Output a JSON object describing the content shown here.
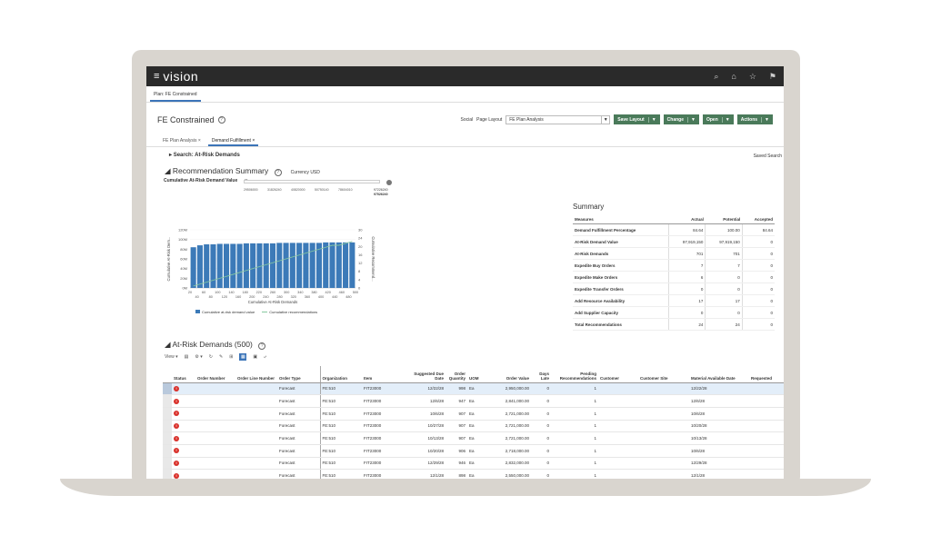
{
  "app": {
    "brand": "vision",
    "tab": "Plan: FE Constrained"
  },
  "header": {
    "title": "FE Constrained",
    "social": "Social",
    "page_layout_label": "Page Layout",
    "page_layout_value": "FE Plan Analysis",
    "buttons": [
      "Save Layout",
      "Change",
      "Open",
      "Actions"
    ]
  },
  "subtabs": [
    "FE Plan Analysis",
    "Demand Fulfillment"
  ],
  "search": {
    "label": "Search: At-Risk Demands",
    "saved": "Saved Search"
  },
  "recommendation": {
    "title": "Recommendation Summary",
    "currency": "Currency  USD",
    "slider_label": "Cumulative At-Risk Demand Value",
    "slider_min": "--",
    "slider_ticks": [
      "29506000",
      "31826240",
      "40820000",
      "50750140",
      "78604010"
    ],
    "slider_max": "97226240",
    "slider_max_bold": "97526240"
  },
  "chart_data": {
    "type": "bar",
    "xlabel": "Cumulative At-Risk Demands",
    "ylabel": "Cumulative At-Risk Dem...",
    "y2label": "Cumulative Recommend...",
    "y_ticks": [
      "120M",
      "100M",
      "80M",
      "60M",
      "40M",
      "20M",
      "0M"
    ],
    "y2_ticks": [
      "30",
      "24",
      "20",
      "16",
      "12",
      "8",
      "4",
      "0"
    ],
    "x_ticks_top": [
      "20",
      "60",
      "100",
      "140",
      "180",
      "220",
      "260",
      "300",
      "340",
      "380",
      "420",
      "460",
      "500"
    ],
    "x_ticks_bottom": [
      "40",
      "80",
      "120",
      "160",
      "200",
      "240",
      "280",
      "320",
      "360",
      "400",
      "440",
      "480"
    ],
    "ylim": [
      0,
      120
    ],
    "y2lim": [
      0,
      30
    ],
    "series": [
      {
        "name": "Cumulative at-risk demand value",
        "values": [
          84,
          88,
          90,
          90,
          91,
          91,
          91,
          91,
          92,
          92,
          92,
          92,
          92,
          93,
          93,
          93,
          93,
          93,
          93,
          93,
          94,
          94,
          94,
          94,
          94
        ]
      },
      {
        "name": "Cumulative recommendations",
        "values": [
          1,
          2,
          3,
          4,
          5,
          6,
          7,
          8,
          9,
          10,
          11,
          12,
          13,
          14,
          15,
          16,
          17,
          18,
          19,
          20,
          21,
          22,
          22,
          23,
          24
        ]
      }
    ],
    "colors": {
      "bar": "#3c7ab8",
      "line": "#88c9a0"
    }
  },
  "summary": {
    "title": "Summary",
    "headers": [
      "Measures",
      "Actual",
      "Potential",
      "Accepted"
    ],
    "rows": [
      [
        "Demand Fulfillment Percentage",
        "84.64",
        "100.00",
        "84.64"
      ],
      [
        "At-Risk Demand Value",
        "97,919,150",
        "97,919,150",
        "0"
      ],
      [
        "At-Risk Demands",
        "701",
        "701",
        "0"
      ],
      [
        "Expedite Buy Orders",
        "7",
        "7",
        "0"
      ],
      [
        "Expedite Make Orders",
        "6",
        "0",
        "0"
      ],
      [
        "Expedite Transfer Orders",
        "0",
        "0",
        "0"
      ],
      [
        "Add Resource Availability",
        "17",
        "17",
        "0"
      ],
      [
        "Add Supplier Capacity",
        "0",
        "0",
        "0"
      ],
      [
        "Total Recommendations",
        "24",
        "24",
        "0"
      ]
    ]
  },
  "atrisk": {
    "title": "At-Risk Demands (500)",
    "view": "View",
    "headers": [
      "Status",
      "Order Number",
      "Order Line Number",
      "Order Type",
      "Organization",
      "Item",
      "Suggested Due Date",
      "Order Quantity",
      "UOM",
      "Order Value",
      "Days Late",
      "Pending Recommendations",
      "Customer",
      "Customer Site",
      "Material Available Date",
      "Requested"
    ],
    "rows": [
      [
        "Forecast",
        "FE:510",
        "FIT23000",
        "12/22/28",
        "998",
        "Ea",
        "2,950,000.00",
        "0",
        "1",
        "12/22/28"
      ],
      [
        "Forecast",
        "FE:510",
        "FIT23000",
        "12/6/28",
        "947",
        "Ea",
        "2,841,000.00",
        "0",
        "1",
        "12/6/28"
      ],
      [
        "Forecast",
        "FE:510",
        "FIT23000",
        "10/6/28",
        "907",
        "Ea",
        "2,721,000.00",
        "0",
        "1",
        "10/6/28"
      ],
      [
        "Forecast",
        "FE:510",
        "FIT23000",
        "10/27/28",
        "907",
        "Ea",
        "2,721,000.00",
        "0",
        "1",
        "10/20/28"
      ],
      [
        "Forecast",
        "FE:510",
        "FIT23000",
        "10/13/28",
        "907",
        "Ea",
        "2,721,000.00",
        "0",
        "1",
        "10/13/28"
      ],
      [
        "Forecast",
        "FE:510",
        "FIT23000",
        "10/20/28",
        "906",
        "Ea",
        "2,718,000.00",
        "0",
        "1",
        "10/6/28"
      ],
      [
        "Forecast",
        "FE:510",
        "FIT23000",
        "12/29/28",
        "946",
        "Ea",
        "2,832,000.00",
        "0",
        "1",
        "12/29/28"
      ],
      [
        "Forecast",
        "FE:510",
        "FIT23000",
        "12/1/28",
        "898",
        "Ea",
        "2,550,000.00",
        "0",
        "1",
        "12/1/28"
      ]
    ]
  }
}
